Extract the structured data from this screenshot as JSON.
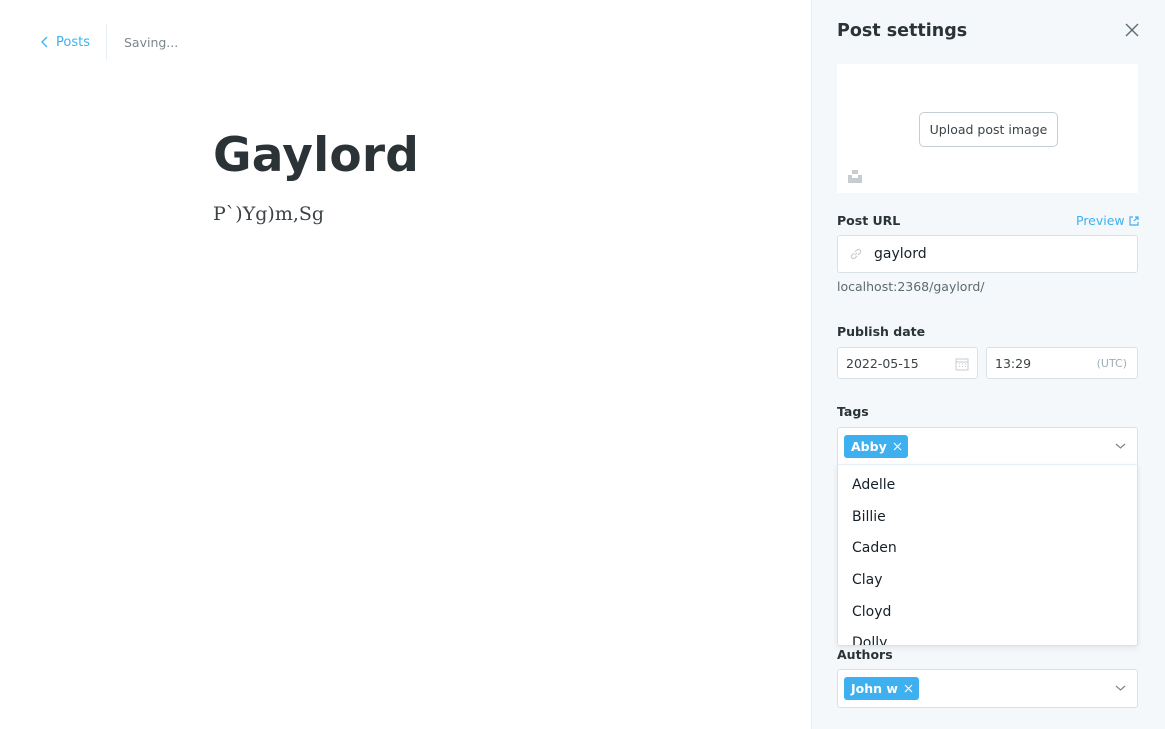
{
  "header": {
    "back_label": "Posts",
    "status": "Saving..."
  },
  "post": {
    "title": "Gaylord",
    "body": "P`)Yg)m,Sg"
  },
  "settings": {
    "title": "Post settings",
    "upload_label": "Upload post image",
    "url_label": "Post URL",
    "preview_label": "Preview",
    "url_value": "gaylord",
    "url_hint": "localhost:2368/gaylord/",
    "publish_label": "Publish date",
    "date_value": "2022-05-15",
    "time_value": "13:29",
    "timezone": "(UTC)",
    "tags_label": "Tags",
    "selected_tag": "Abby",
    "tag_options": [
      "Adelle",
      "Billie",
      "Caden",
      "Clay",
      "Cloyd",
      "Dolly"
    ],
    "authors_label": "Authors",
    "selected_author": "John w"
  },
  "colors": {
    "accent": "#3eb0ef",
    "panel_bg": "#f4f8fb",
    "text_dark": "#2b3337"
  },
  "icons": [
    "chevron-left-icon",
    "close-icon",
    "unsplash-icon",
    "external-link-icon",
    "link-icon",
    "calendar-icon",
    "remove-token-icon",
    "chevron-down-icon"
  ]
}
